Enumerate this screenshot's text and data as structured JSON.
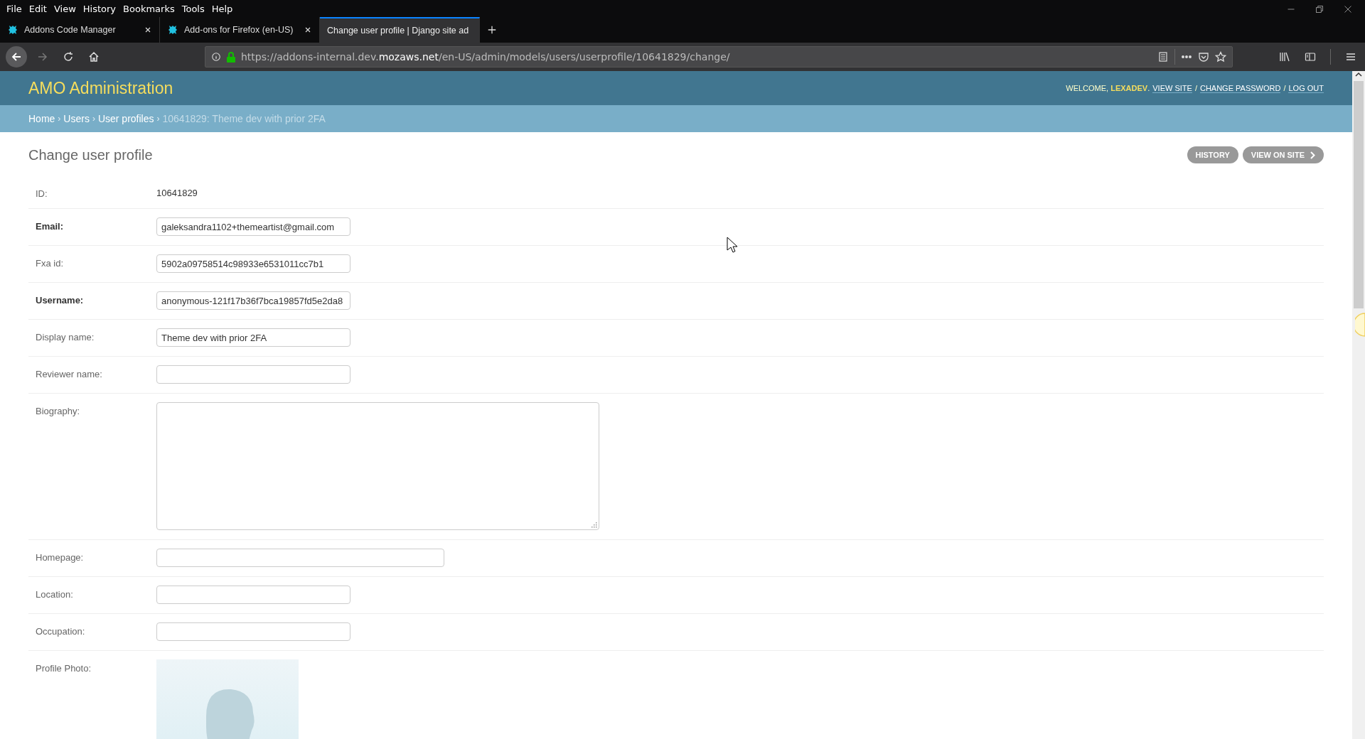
{
  "menu_bar": [
    "File",
    "Edit",
    "View",
    "History",
    "Bookmarks",
    "Tools",
    "Help"
  ],
  "tabs": [
    {
      "title": "Addons Code Manager",
      "selected": false,
      "favicon": true
    },
    {
      "title": "Add-ons for Firefox (en-US)",
      "selected": false,
      "favicon": true
    },
    {
      "title": "Change user profile | Django site ad",
      "selected": true,
      "favicon": false
    }
  ],
  "url": "https://addons-internal.dev.**mozaws.net**/en-US/admin/models/users/userprofile/10641829/change/",
  "header": {
    "title": "AMO Administration",
    "welcome": "WELCOME, **LEXADEV**.",
    "links": [
      {
        "label": "VIEW SITE"
      },
      {
        "label": "CHANGE PASSWORD",
        "prefix": "/"
      },
      {
        "label": "LOG OUT",
        "prefix": "/"
      }
    ]
  },
  "breadcrumbs": [
    {
      "label": "Home",
      "current": false
    },
    {
      "label": "Users",
      "current": false,
      "prefix": "›"
    },
    {
      "label": "User profiles",
      "current": false,
      "prefix": "›"
    },
    {
      "label": "10641829: Theme dev with prior 2FA",
      "current": true,
      "prefix": "›"
    }
  ],
  "page_title": "Change user profile",
  "object_tools": [
    {
      "label": "HISTORY",
      "arrow": false
    },
    {
      "label": "VIEW ON SITE",
      "arrow": true
    }
  ],
  "fields": [
    {
      "kind": "readonly",
      "label": "ID:",
      "required": false,
      "value": "10641829"
    },
    {
      "kind": "text",
      "label": "Email:",
      "required": true,
      "value": "galeksandra1102+themeartist@gmail.com"
    },
    {
      "kind": "text",
      "label": "Fxa id:",
      "required": false,
      "value": "5902a09758514c98933e6531011cc7b1"
    },
    {
      "kind": "text",
      "label": "Username:",
      "required": true,
      "value": "anonymous-121f17b36f7bca19857fd5e2da8"
    },
    {
      "kind": "text",
      "label": "Display name:",
      "required": false,
      "value": "Theme dev with prior 2FA"
    },
    {
      "kind": "text",
      "label": "Reviewer name:",
      "required": false
    },
    {
      "kind": "textarea",
      "label": "Biography:",
      "required": false
    },
    {
      "kind": "wide",
      "label": "Homepage:",
      "required": false
    },
    {
      "kind": "text",
      "label": "Location:",
      "required": false
    },
    {
      "kind": "text",
      "label": "Occupation:",
      "required": false
    },
    {
      "label": "Profile Photo:",
      "required": false
    }
  ]
}
